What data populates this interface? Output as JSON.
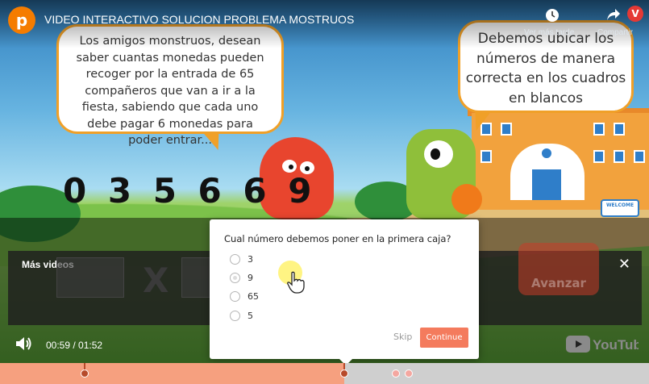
{
  "window": {
    "channel_initial": "p",
    "video_title": "VIDEO INTERACTIVO SOLUCION PROBLEMA MOSTRUOS",
    "watch_later_label": "Ver más tarde",
    "share_label": "Compartir",
    "user_initial": "V"
  },
  "scene": {
    "left_bubble": "Los amigos monstruos, desean saber cuantas monedas pueden recoger por la entrada de 65 compañeros que van a ir a la fiesta, sabiendo que cada uno debe pagar 6 monedas para poder entrar...",
    "right_bubble": "Debemos ubicar los números de manera correcta en los cuadros en blancos",
    "number_tiles": "0 3 5 6 6 9",
    "multiply_sign": "X",
    "ghost_button": "Avanzar",
    "welcome_sign": "WELCOME"
  },
  "player": {
    "more_videos_label": "Más videos",
    "close_glyph": "✕",
    "time_display": "00:59 / 01:52",
    "youtube_label": "YouTube",
    "played_fraction": 0.53
  },
  "quiz": {
    "question": "Cual número debemos poner en la primera caja?",
    "options": [
      "3",
      "9",
      "65",
      "5"
    ],
    "hovered_option": "9",
    "skip_label": "Skip",
    "continue_label": "Continue"
  },
  "timeline": {
    "markers": [
      {
        "time_fraction": 0.13,
        "state": "passed"
      },
      {
        "time_fraction": 0.53,
        "state": "current"
      },
      {
        "time_fraction": 0.61,
        "state": "upcoming"
      },
      {
        "time_fraction": 0.63,
        "state": "upcoming"
      }
    ]
  },
  "colors": {
    "accent": "#f47b5d",
    "channel_avatar": "#f57c00",
    "bubble_border": "#f0a028"
  },
  "icons": [
    "channel-avatar-icon",
    "clock-icon",
    "share-icon",
    "close-icon",
    "volume-icon",
    "youtube-logo-icon",
    "hand-cursor-icon"
  ]
}
